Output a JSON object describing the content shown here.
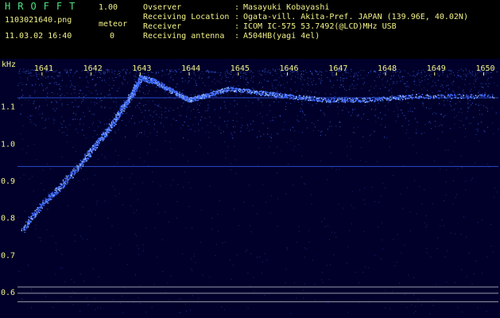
{
  "header": {
    "app_title": "HROFFT",
    "app_version": "1.00",
    "file_name": "1103021640.png",
    "meteor_label": "meteor",
    "date_time": "11.03.02 16:40",
    "meteor_count": "0",
    "info": [
      {
        "label": "Ovserver",
        "value": "Masayuki Kobayashi"
      },
      {
        "label": "Receiving Location",
        "value": "Ogata-vill. Akita-Pref. JAPAN (139.96E, 40.02N)"
      },
      {
        "label": "Receiver",
        "value": "ICOM IC-575 53.7492(@LCD)MHz USB"
      },
      {
        "label": "Receiving antenna",
        "value": "A504HB(yagi 4el)"
      }
    ]
  },
  "colors": {
    "background": "#000000",
    "plot_background": "#00002a",
    "label_yellow": "#f2f28a",
    "label_green": "#4fe07f",
    "signal_blue": "#3f6bff"
  },
  "chart_data": {
    "type": "heatmap",
    "ylabel": "kHz",
    "x_ticks": [
      "1641",
      "1642",
      "1643",
      "1644",
      "1645",
      "1646",
      "1647",
      "1648",
      "1649",
      "1650"
    ],
    "y_ticks": [
      "1.1",
      "1.0",
      "0.9",
      "0.8",
      "0.7",
      "0.6"
    ],
    "xlim": [
      1640.5,
      1650.3
    ],
    "ylim": [
      0.54,
      1.2
    ],
    "meteor_trail": [
      {
        "x": 1640.6,
        "y": 0.77
      },
      {
        "x": 1641.0,
        "y": 0.84
      },
      {
        "x": 1641.4,
        "y": 0.89
      },
      {
        "x": 1641.8,
        "y": 0.95
      },
      {
        "x": 1642.1,
        "y": 1.0
      },
      {
        "x": 1642.4,
        "y": 1.05
      },
      {
        "x": 1642.65,
        "y": 1.1
      },
      {
        "x": 1642.85,
        "y": 1.14
      },
      {
        "x": 1643.0,
        "y": 1.18
      },
      {
        "x": 1643.3,
        "y": 1.17
      },
      {
        "x": 1643.7,
        "y": 1.14
      },
      {
        "x": 1644.0,
        "y": 1.12
      },
      {
        "x": 1644.3,
        "y": 1.13
      },
      {
        "x": 1644.8,
        "y": 1.15
      },
      {
        "x": 1645.4,
        "y": 1.14
      },
      {
        "x": 1646.0,
        "y": 1.13
      },
      {
        "x": 1646.8,
        "y": 1.12
      },
      {
        "x": 1647.6,
        "y": 1.12
      },
      {
        "x": 1648.6,
        "y": 1.13
      },
      {
        "x": 1650.2,
        "y": 1.13
      }
    ],
    "horizontal_lines": [
      1.125,
      0.94,
      0.615,
      0.598,
      0.575
    ],
    "grid": false
  }
}
